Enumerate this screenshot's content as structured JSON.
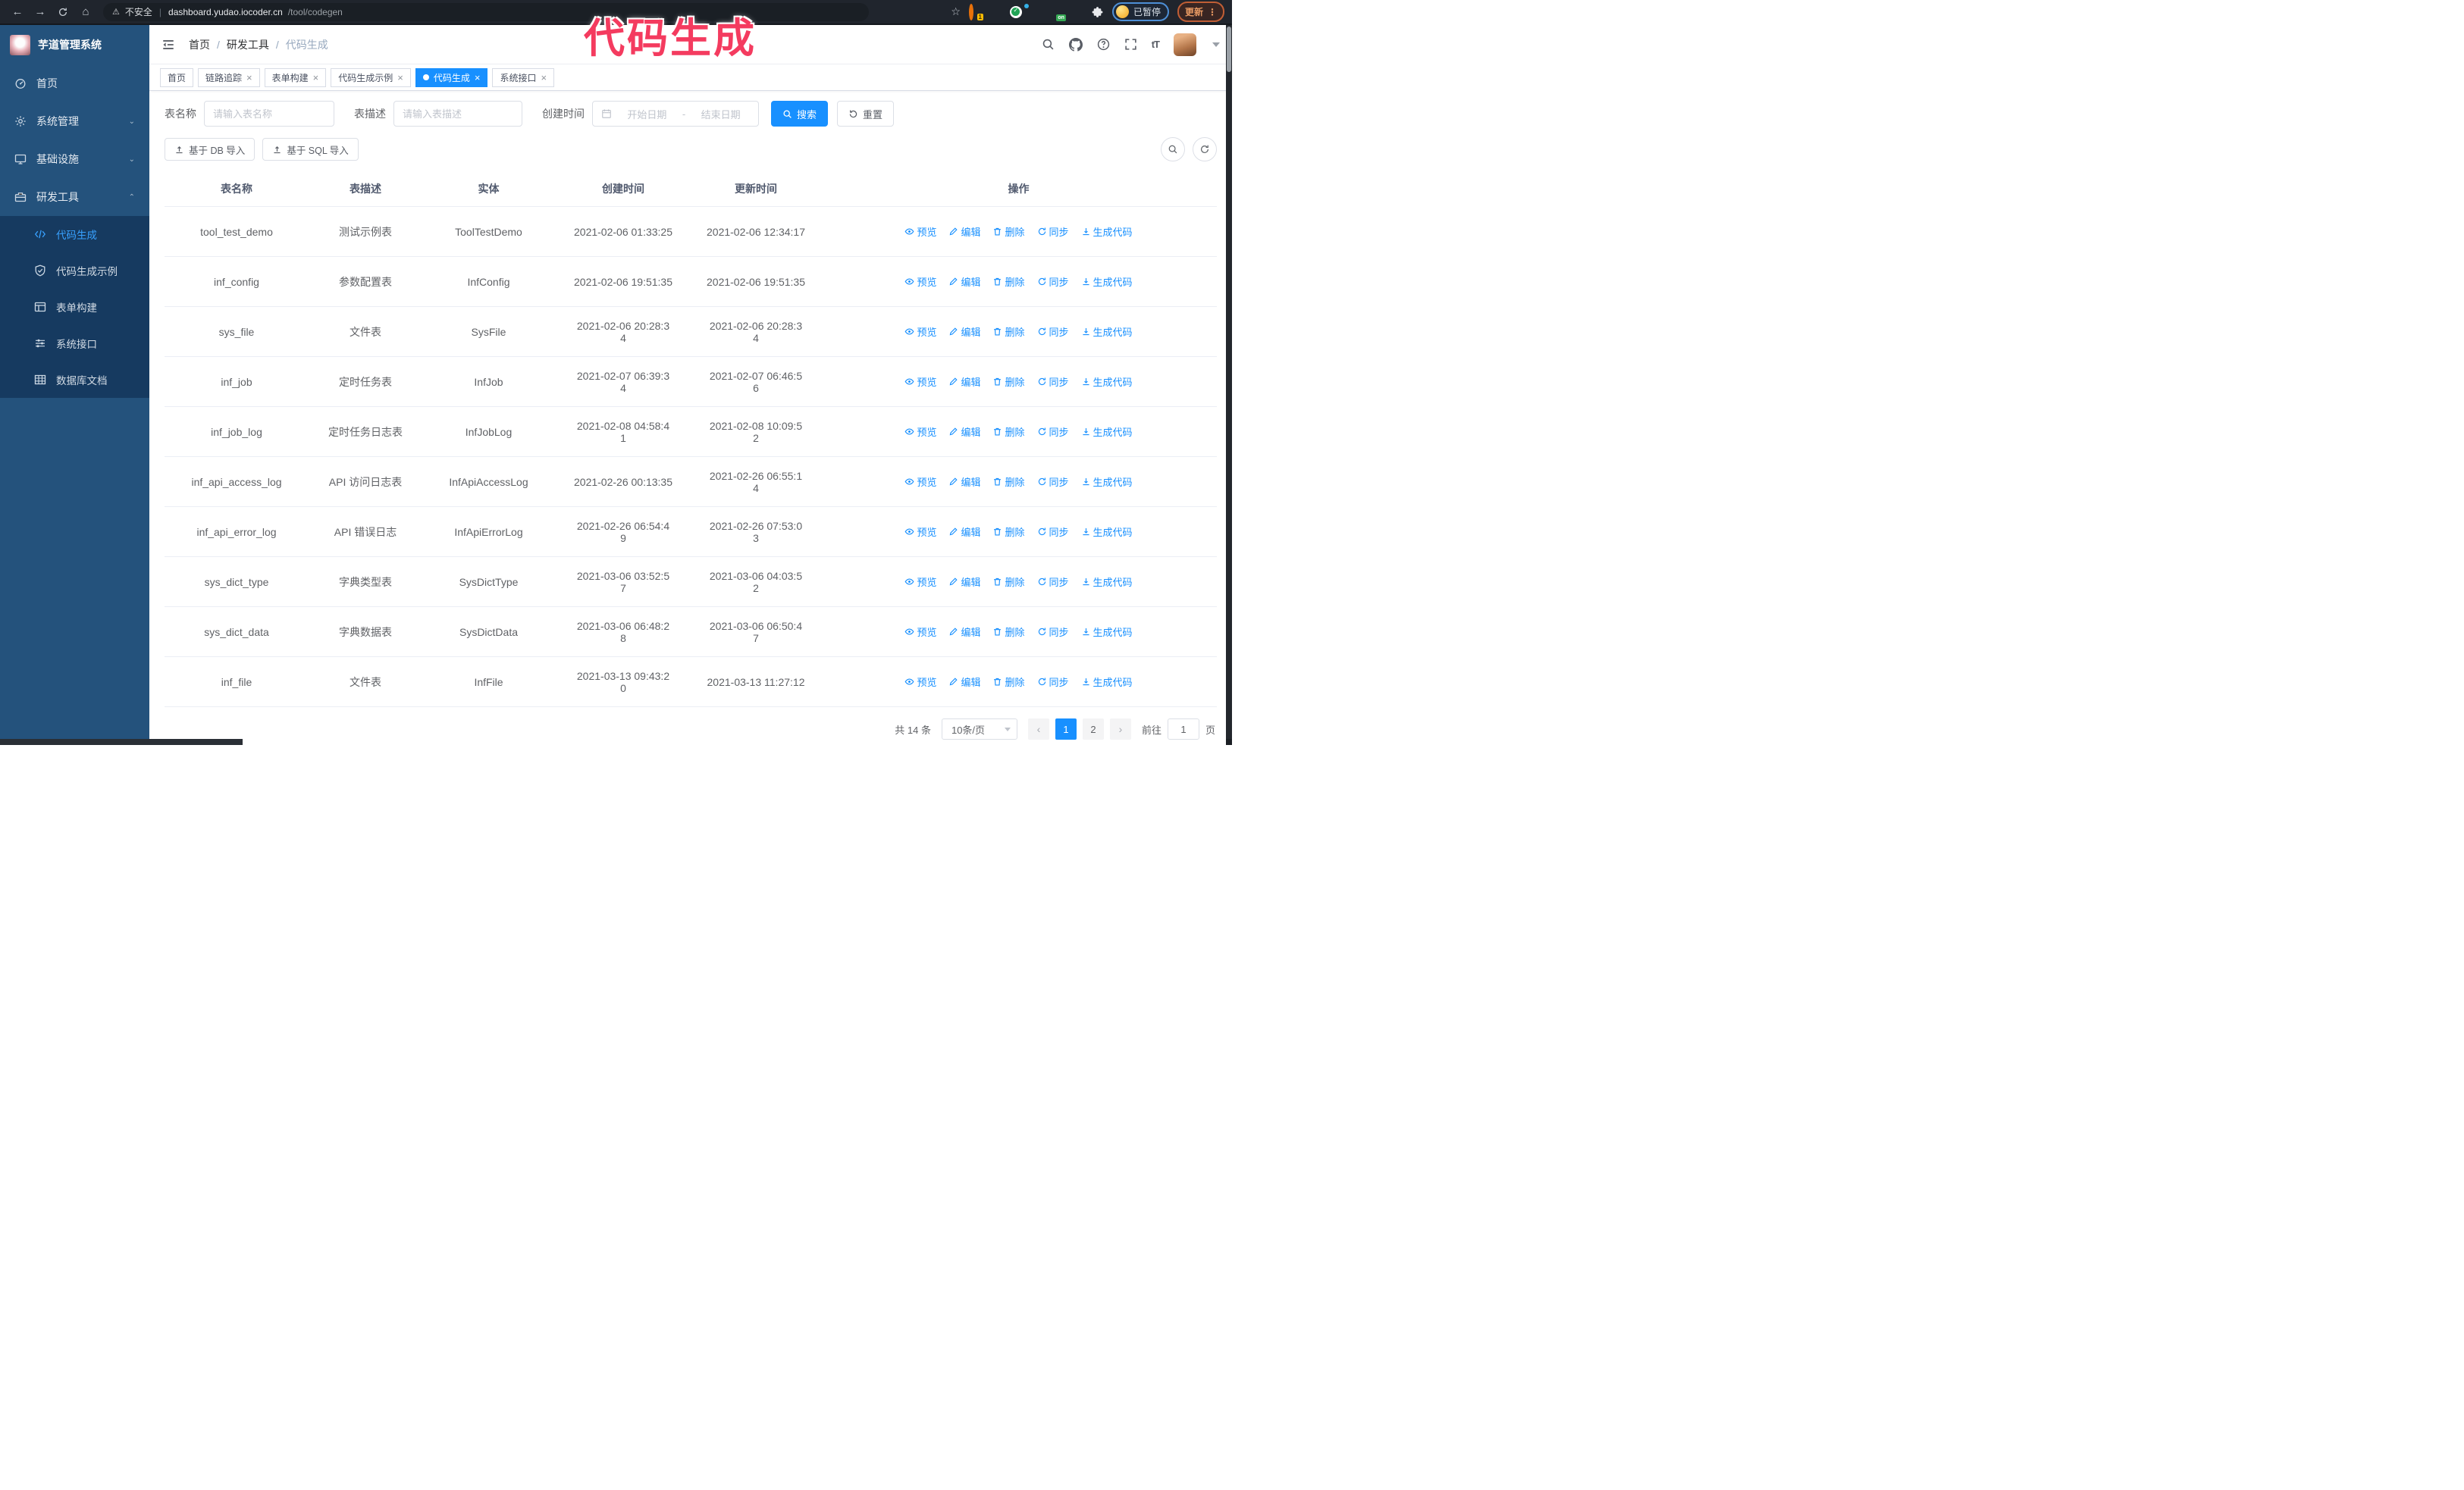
{
  "overlay": {
    "watermark": "代码生成"
  },
  "browser": {
    "security_label": "不安全",
    "url_host": "dashboard.yudao.iocoder.cn",
    "url_path": "/tool/codegen",
    "extension_badge": "1",
    "extension_on_badge": "on",
    "profile_status": "已暂停",
    "update_label": "更新",
    "menu_dots": "⋮"
  },
  "sidebar": {
    "app_title": "芋道管理系统",
    "items": [
      {
        "label": "首页",
        "icon": "dashboard-icon"
      },
      {
        "label": "系统管理",
        "icon": "gear-icon",
        "expandable": true,
        "expanded": false
      },
      {
        "label": "基础设施",
        "icon": "monitor-icon",
        "expandable": true,
        "expanded": false
      },
      {
        "label": "研发工具",
        "icon": "toolbox-icon",
        "expandable": true,
        "expanded": true,
        "children": [
          {
            "label": "代码生成",
            "icon": "code-icon",
            "active": true
          },
          {
            "label": "代码生成示例",
            "icon": "shield-check-icon"
          },
          {
            "label": "表单构建",
            "icon": "form-icon"
          },
          {
            "label": "系统接口",
            "icon": "sliders-icon"
          },
          {
            "label": "数据库文档",
            "icon": "database-doc-icon"
          }
        ]
      }
    ]
  },
  "header": {
    "breadcrumb": [
      "首页",
      "研发工具",
      "代码生成"
    ],
    "separator": "/"
  },
  "tabs": [
    {
      "label": "首页",
      "closable": false,
      "active": false
    },
    {
      "label": "链路追踪",
      "closable": true,
      "active": false
    },
    {
      "label": "表单构建",
      "closable": true,
      "active": false
    },
    {
      "label": "代码生成示例",
      "closable": true,
      "active": false
    },
    {
      "label": "代码生成",
      "closable": true,
      "active": true
    },
    {
      "label": "系统接口",
      "closable": true,
      "active": false
    }
  ],
  "search": {
    "name_label": "表名称",
    "name_placeholder": "请输入表名称",
    "desc_label": "表描述",
    "desc_placeholder": "请输入表描述",
    "time_label": "创建时间",
    "start_placeholder": "开始日期",
    "range_separator": "-",
    "end_placeholder": "结束日期",
    "search_button": "搜索",
    "reset_button": "重置"
  },
  "toolbar": {
    "import_db_label": "基于 DB 导入",
    "import_sql_label": "基于 SQL 导入"
  },
  "table": {
    "headers": [
      "表名称",
      "表描述",
      "实体",
      "创建时间",
      "更新时间",
      "操作"
    ],
    "actions": [
      "预览",
      "编辑",
      "删除",
      "同步",
      "生成代码"
    ],
    "action_icons": [
      "eye-icon",
      "edit-icon",
      "delete-icon",
      "sync-icon",
      "download-icon"
    ],
    "rows": [
      {
        "name": "tool_test_demo",
        "desc": "测试示例表",
        "entity": "ToolTestDemo",
        "created": "2021-02-06 01:33:25",
        "updated": "2021-02-06 12:34:17"
      },
      {
        "name": "inf_config",
        "desc": "参数配置表",
        "entity": "InfConfig",
        "created": "2021-02-06 19:51:35",
        "updated": "2021-02-06 19:51:35"
      },
      {
        "name": "sys_file",
        "desc": "文件表",
        "entity": "SysFile",
        "created": "2021-02-06 20:28:3\n4",
        "updated": "2021-02-06 20:28:3\n4"
      },
      {
        "name": "inf_job",
        "desc": "定时任务表",
        "entity": "InfJob",
        "created": "2021-02-07 06:39:3\n4",
        "updated": "2021-02-07 06:46:5\n6"
      },
      {
        "name": "inf_job_log",
        "desc": "定时任务日志表",
        "entity": "InfJobLog",
        "created": "2021-02-08 04:58:4\n1",
        "updated": "2021-02-08 10:09:5\n2"
      },
      {
        "name": "inf_api_access_log",
        "desc": "API 访问日志表",
        "entity": "InfApiAccessLog",
        "created": "2021-02-26 00:13:35",
        "updated": "2021-02-26 06:55:1\n4"
      },
      {
        "name": "inf_api_error_log",
        "desc": "API 错误日志",
        "entity": "InfApiErrorLog",
        "created": "2021-02-26 06:54:4\n9",
        "updated": "2021-02-26 07:53:0\n3"
      },
      {
        "name": "sys_dict_type",
        "desc": "字典类型表",
        "entity": "SysDictType",
        "created": "2021-03-06 03:52:5\n7",
        "updated": "2021-03-06 04:03:5\n2"
      },
      {
        "name": "sys_dict_data",
        "desc": "字典数据表",
        "entity": "SysDictData",
        "created": "2021-03-06 06:48:2\n8",
        "updated": "2021-03-06 06:50:4\n7"
      },
      {
        "name": "inf_file",
        "desc": "文件表",
        "entity": "InfFile",
        "created": "2021-03-13 09:43:2\n0",
        "updated": "2021-03-13 11:27:12"
      }
    ]
  },
  "pagination": {
    "total_text": "共 14 条",
    "page_size_text": "10条/页",
    "pages": [
      "1",
      "2"
    ],
    "active_page": "1",
    "goto_label": "前往",
    "goto_value": "1",
    "goto_suffix": "页"
  },
  "colors": {
    "primary": "#1890ff",
    "sidebar_bg": "#24527c",
    "submenu_bg": "#163a60",
    "watermark": "#f43b5f",
    "browser_bar": "#20252d"
  }
}
